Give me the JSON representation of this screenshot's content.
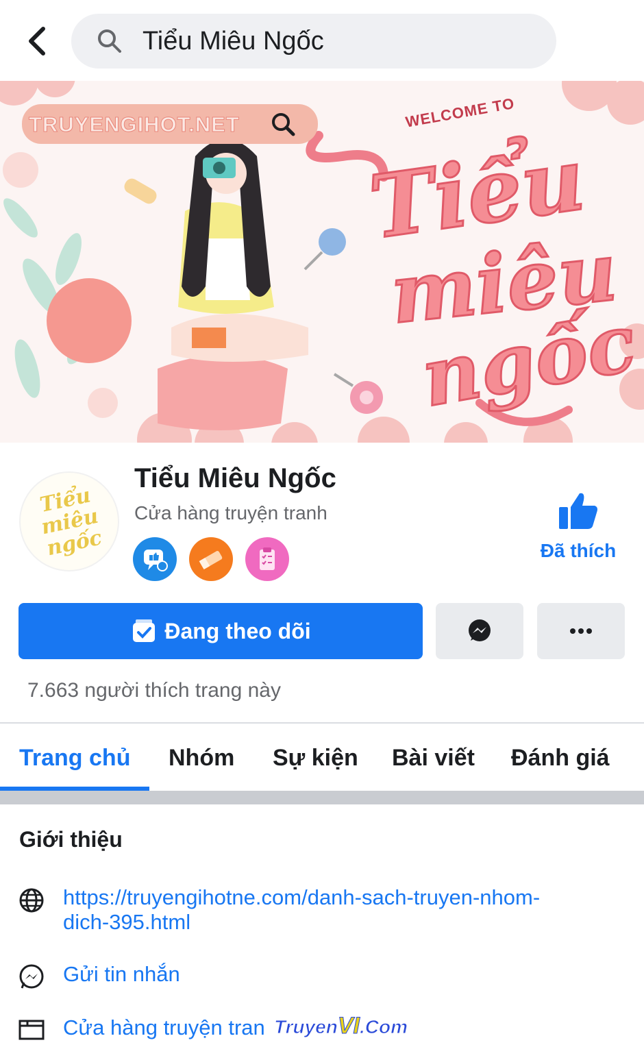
{
  "search": {
    "query": "Tiểu Miêu Ngốc"
  },
  "cover": {
    "site_text": "TRUYENGIHOT.NET",
    "welcome": "WELCOME TO",
    "script_line1": "Tiểu",
    "script_line2": "miêu",
    "script_line3": "ngốc"
  },
  "avatar": {
    "text": "Tiểu miêu ngốc"
  },
  "profile": {
    "name": "Tiểu Miêu Ngốc",
    "category": "Cửa hàng truyện tranh",
    "liked_label": "Đã thích"
  },
  "actions": {
    "follow_label": "Đang theo dõi",
    "likes_count": "7.663 người thích trang này"
  },
  "tabs": [
    "Trang chủ",
    "Nhóm",
    "Sự kiện",
    "Bài viết",
    "Đánh giá"
  ],
  "intro": {
    "title": "Giới thiệu",
    "website_line1": "https://truyengihotne.com/danh-sach-truyen-nhom-",
    "website_line2": "dich-395.html",
    "message": "Gửi tin nhắn",
    "category": "Cửa hàng truyện tran"
  },
  "watermark": {
    "prefix": "Truyen",
    "vi": "VI",
    "suffix": ".Com"
  },
  "colors": {
    "accent": "#1877f2",
    "cover_pink": "#f58d94"
  }
}
